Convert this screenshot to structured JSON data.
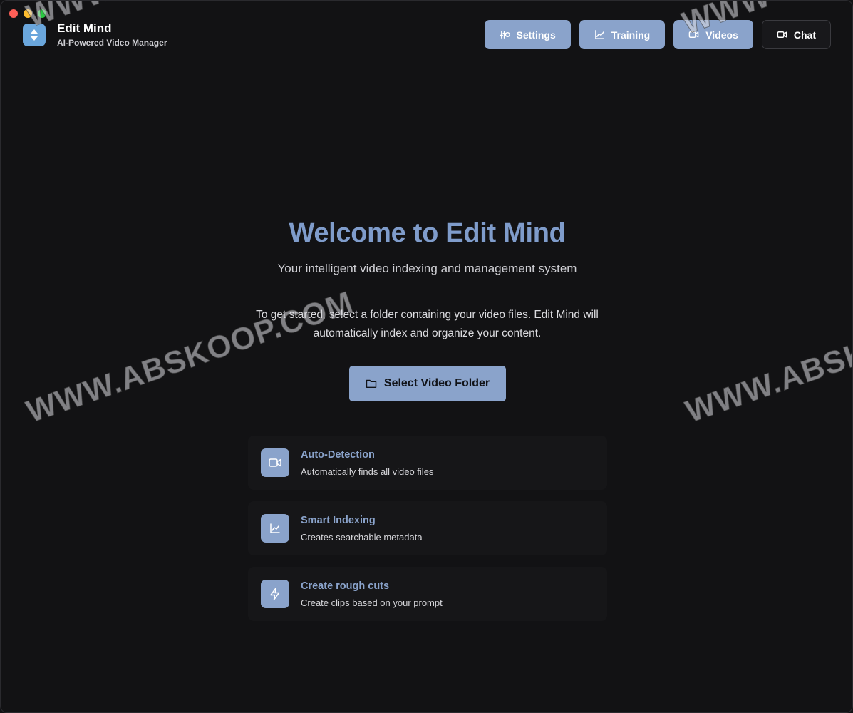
{
  "app": {
    "title": "Edit Mind",
    "subtitle": "AI-Powered Video Manager"
  },
  "nav": [
    {
      "label": "Settings",
      "icon": "settings-icon"
    },
    {
      "label": "Training",
      "icon": "chart-icon"
    },
    {
      "label": "Videos",
      "icon": "video-icon"
    },
    {
      "label": "Chat",
      "icon": "video-icon"
    }
  ],
  "hero": {
    "title": "Welcome to Edit Mind",
    "tagline": "Your intelligent video indexing and management system",
    "intro": "To get started, select a folder containing your video files. Edit Mind will automatically index and organize your content."
  },
  "select_button": {
    "label": "Select Video Folder",
    "icon": "folder-icon"
  },
  "features": [
    {
      "title": "Auto-Detection",
      "description": "Automatically finds all video files",
      "icon": "video-icon"
    },
    {
      "title": "Smart Indexing",
      "description": "Creates searchable metadata",
      "icon": "chart-icon"
    },
    {
      "title": "Create rough cuts",
      "description": "Create clips based on your prompt",
      "icon": "lightning-icon"
    }
  ],
  "watermarks": [
    "WWW.ABSKOOP.COM",
    "WWW.ABSKO",
    "WWW.",
    "WWW"
  ],
  "colors": {
    "background": "#121214",
    "accent": "#8aa3cb",
    "heading": "#7f9ccb",
    "logo": "#6aa6dc"
  }
}
